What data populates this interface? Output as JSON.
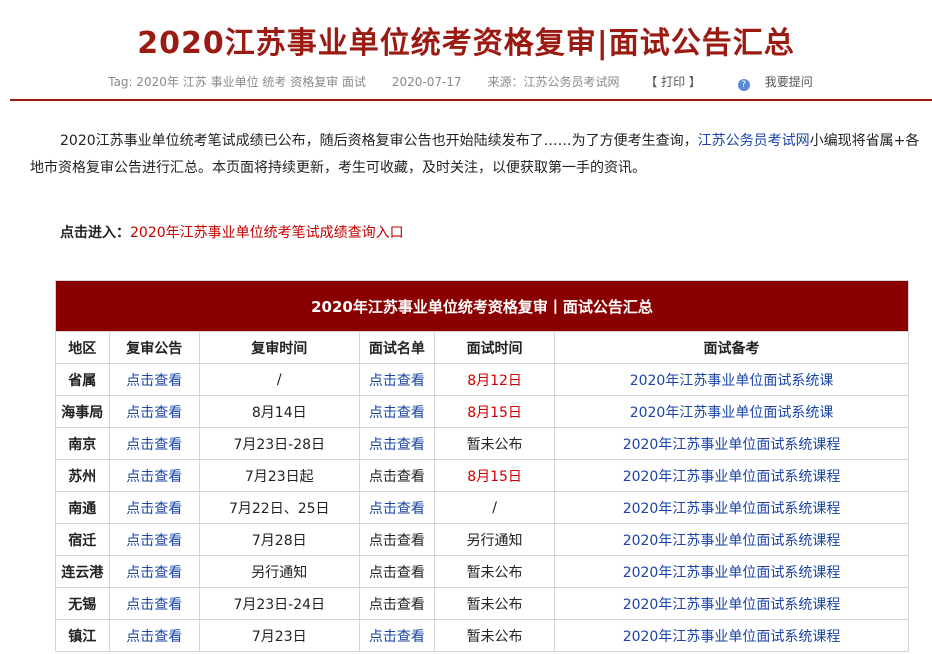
{
  "header": {
    "title": "2020江苏事业单位统考资格复审|面试公告汇总",
    "tag_label": "Tag: 2020年 江苏 事业单位 统考 资格复审 面试",
    "date": "2020-07-17",
    "source": "来源：江苏公务员考试网",
    "print": "【 打印 】",
    "ask": "我要提问"
  },
  "intro": {
    "text_before": "2020江苏事业单位统考笔试成绩已公布，随后资格复审公告也开始陆续发布了……为了方便考生查询，",
    "link": "江苏公务员考试网",
    "text_after": "小编现将省属+各地市资格复审公告进行汇总。本页面将持续更新，考生可收藏，及时关注，以便获取第一手的资讯。"
  },
  "entry": {
    "label": "点击进入：",
    "link": "2020年江苏事业单位统考笔试成绩查询入口"
  },
  "table": {
    "title": "2020年江苏事业单位统考资格复审丨面试公告汇总",
    "headers": [
      "地区",
      "复审公告",
      "复审时间",
      "面试名单",
      "面试时间",
      "面试备考"
    ],
    "rows": [
      {
        "region": "省属",
        "notice": "点击查看",
        "review_time": "/",
        "list": "点击查看",
        "list_link": true,
        "interview": "8月12日",
        "interview_red": true,
        "prep": "2020年江苏事业单位面试系统课"
      },
      {
        "region": "海事局",
        "notice": "点击查看",
        "review_time": "8月14日",
        "list": "点击查看",
        "list_link": true,
        "interview": "8月15日",
        "interview_red": true,
        "prep": "2020年江苏事业单位面试系统课"
      },
      {
        "region": "南京",
        "notice": "点击查看",
        "review_time": "7月23日-28日",
        "list": "点击查看",
        "list_link": true,
        "interview": "暂未公布",
        "interview_red": false,
        "prep": "2020年江苏事业单位面试系统课程"
      },
      {
        "region": "苏州",
        "notice": "点击查看",
        "review_time": "7月23日起",
        "list": "点击查看",
        "list_link": false,
        "interview": "8月15日",
        "interview_red": true,
        "prep": "2020年江苏事业单位面试系统课程"
      },
      {
        "region": "南通",
        "notice": "点击查看",
        "review_time": "7月22日、25日",
        "list": "点击查看",
        "list_link": true,
        "interview": "/",
        "interview_red": false,
        "prep": "2020年江苏事业单位面试系统课程"
      },
      {
        "region": "宿迁",
        "notice": "点击查看",
        "review_time": "7月28日",
        "list": "点击查看",
        "list_link": false,
        "interview": "另行通知",
        "interview_red": false,
        "prep": "2020年江苏事业单位面试系统课程"
      },
      {
        "region": "连云港",
        "notice": "点击查看",
        "review_time": "另行通知",
        "list": "点击查看",
        "list_link": false,
        "interview": "暂未公布",
        "interview_red": false,
        "prep": "2020年江苏事业单位面试系统课程"
      },
      {
        "region": "无锡",
        "notice": "点击查看",
        "review_time": "7月23日-24日",
        "list": "点击查看",
        "list_link": false,
        "interview": "暂未公布",
        "interview_red": false,
        "prep": "2020年江苏事业单位面试系统课程"
      },
      {
        "region": "镇江",
        "notice": "点击查看",
        "review_time": "7月23日",
        "list": "点击查看",
        "list_link": true,
        "interview": "暂未公布",
        "interview_red": false,
        "prep": "2020年江苏事业单位面试系统课程"
      }
    ]
  },
  "colors": {
    "brand": "#9b1b13",
    "table_header": "#8a0000",
    "link": "#1a44a8",
    "highlight": "#d40000"
  },
  "icons": {
    "ask": "question-icon"
  }
}
